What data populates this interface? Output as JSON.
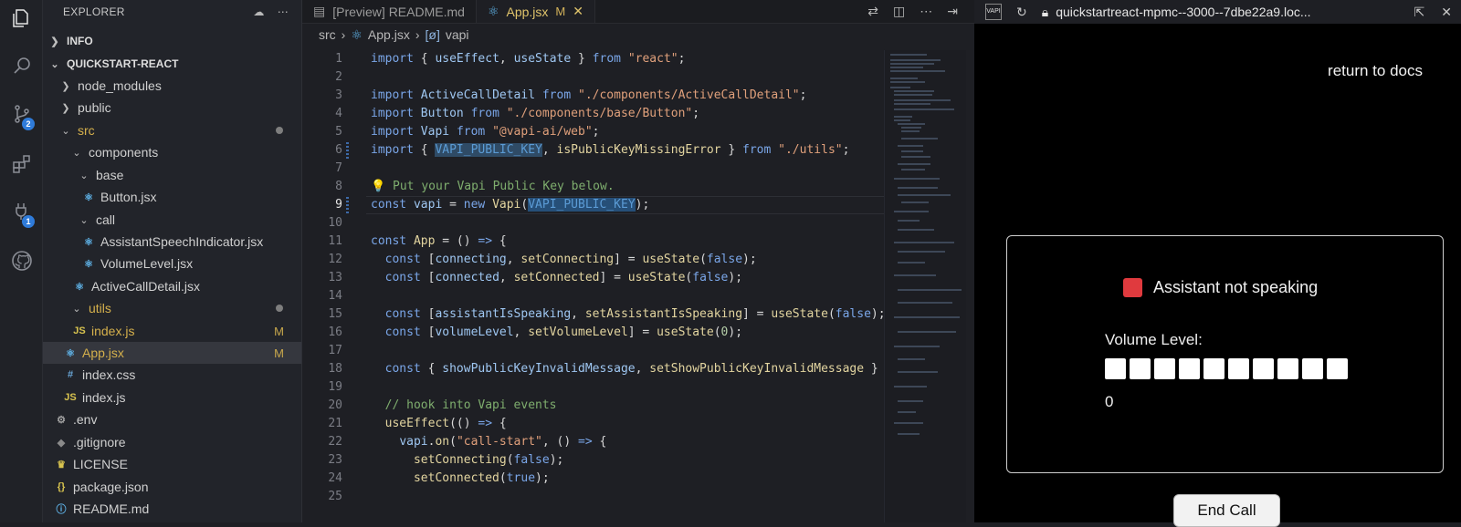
{
  "sidebar": {
    "title": "EXPLORER",
    "sections": {
      "info": "INFO",
      "project": "QUICKSTART-REACT"
    },
    "items": [
      {
        "label": "node_modules"
      },
      {
        "label": "public"
      },
      {
        "label": "src"
      },
      {
        "label": "components"
      },
      {
        "label": "base"
      },
      {
        "label": "Button.jsx"
      },
      {
        "label": "call"
      },
      {
        "label": "AssistantSpeechIndicator.jsx"
      },
      {
        "label": "VolumeLevel.jsx"
      },
      {
        "label": "ActiveCallDetail.jsx"
      },
      {
        "label": "utils"
      },
      {
        "label": "index.js",
        "mark": "M"
      },
      {
        "label": "App.jsx",
        "mark": "M"
      },
      {
        "label": "index.css"
      },
      {
        "label": "index.js"
      },
      {
        "label": ".env"
      },
      {
        "label": ".gitignore"
      },
      {
        "label": "LICENSE"
      },
      {
        "label": "package.json"
      },
      {
        "label": "README.md"
      }
    ]
  },
  "activity": {
    "scm_badge": "2",
    "ext_badge": "1"
  },
  "tabs": [
    {
      "label": "[Preview] README.md"
    },
    {
      "label": "App.jsx",
      "mark": "M"
    }
  ],
  "breadcrumb": {
    "a": "src",
    "b": "App.jsx",
    "c": "vapi"
  },
  "code": {
    "line_numbers": [
      "1",
      "2",
      "3",
      "4",
      "5",
      "6",
      "7",
      "8",
      "9",
      "10",
      "11",
      "12",
      "13",
      "14",
      "15",
      "16",
      "17",
      "18",
      "19",
      "20",
      "21",
      "22",
      "23",
      "24",
      "25"
    ],
    "current_line": "9"
  },
  "browser": {
    "url": "quickstartreact-mpmc--3000--7dbe22a9.loc...",
    "return_link": "return to docs",
    "speaking_status": "Assistant not speaking",
    "volume_label": "Volume Level:",
    "volume_value": "0",
    "end_call": "End Call",
    "status_color": "#e03a3e"
  }
}
